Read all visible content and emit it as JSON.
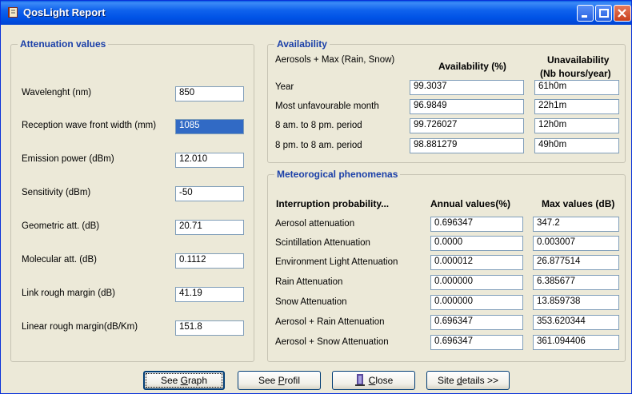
{
  "window": {
    "title": "QosLight Report"
  },
  "attenuation": {
    "title": "Attenuation values",
    "rows": [
      {
        "label": "Wavelenght (nm)",
        "value": "850"
      },
      {
        "label": "Reception wave front width (mm)",
        "value": "1085"
      },
      {
        "label": "Emission power (dBm)",
        "value": "12.010"
      },
      {
        "label": "Sensitivity (dBm)",
        "value": "-50"
      },
      {
        "label": "Geometric att. (dB)",
        "value": "20.71"
      },
      {
        "label": "Molecular att. (dB)",
        "value": "0.1112"
      },
      {
        "label": "Link rough margin (dB)",
        "value": "41.19"
      },
      {
        "label": "Linear rough margin(dB/Km)",
        "value": "151.8"
      }
    ]
  },
  "availability": {
    "title": "Availability",
    "subtitle": "Aerosols + Max (Rain, Snow)",
    "col_availability": "Availability (%)",
    "col_unavailability_1": "Unavailability",
    "col_unavailability_2": "(Nb hours/year)",
    "rows": [
      {
        "label": "Year",
        "availability": "99.3037",
        "unavailability": "61h0m"
      },
      {
        "label": "Most unfavourable month",
        "availability": "96.9849",
        "unavailability": "22h1m"
      },
      {
        "label": "8 am. to 8 pm. period",
        "availability": "99.726027",
        "unavailability": "12h0m"
      },
      {
        "label": "8 pm. to 8 am. period",
        "availability": "98.881279",
        "unavailability": "49h0m"
      }
    ]
  },
  "meteo": {
    "title": "Meteorogical phenomenas",
    "col_label": "Interruption probability...",
    "col_annual": "Annual values(%)",
    "col_max": "Max values (dB)",
    "rows": [
      {
        "label": "Aerosol attenuation",
        "annual": "0.696347",
        "max": "347.2"
      },
      {
        "label": "Scintillation Attenuation",
        "annual": "0.0000",
        "max": "0.003007"
      },
      {
        "label": "Environment Light Attenuation",
        "annual": "0.000012",
        "max": "26.877514"
      },
      {
        "label": "Rain Attenuation",
        "annual": "0.000000",
        "max": "6.385677"
      },
      {
        "label": "Snow Attenuation",
        "annual": "0.000000",
        "max": "13.859738"
      },
      {
        "label": "Aerosol + Rain Attenuation",
        "annual": "0.696347",
        "max": "353.620344"
      },
      {
        "label": "Aerosol + Snow Attenuation",
        "annual": "0.696347",
        "max": "361.094406"
      }
    ]
  },
  "buttons": {
    "see_graph_pre": "See ",
    "see_graph_u": "G",
    "see_graph_post": "raph",
    "see_profil_pre": "See ",
    "see_profil_u": "P",
    "see_profil_post": "rofil",
    "close_u": "C",
    "close_post": "lose",
    "site_details_pre": "Site ",
    "site_details_u": "d",
    "site_details_post": "etails >>"
  },
  "icons": {
    "app": "report-book-icon",
    "minimize": "minimize-icon",
    "maximize": "maximize-icon",
    "close": "close-icon",
    "close_button": "door-exit-icon"
  },
  "colors": {
    "titlebar": "#0053e6",
    "group_title": "#1a3fa8",
    "selection": "#316ac5",
    "face": "#ece9d8"
  }
}
